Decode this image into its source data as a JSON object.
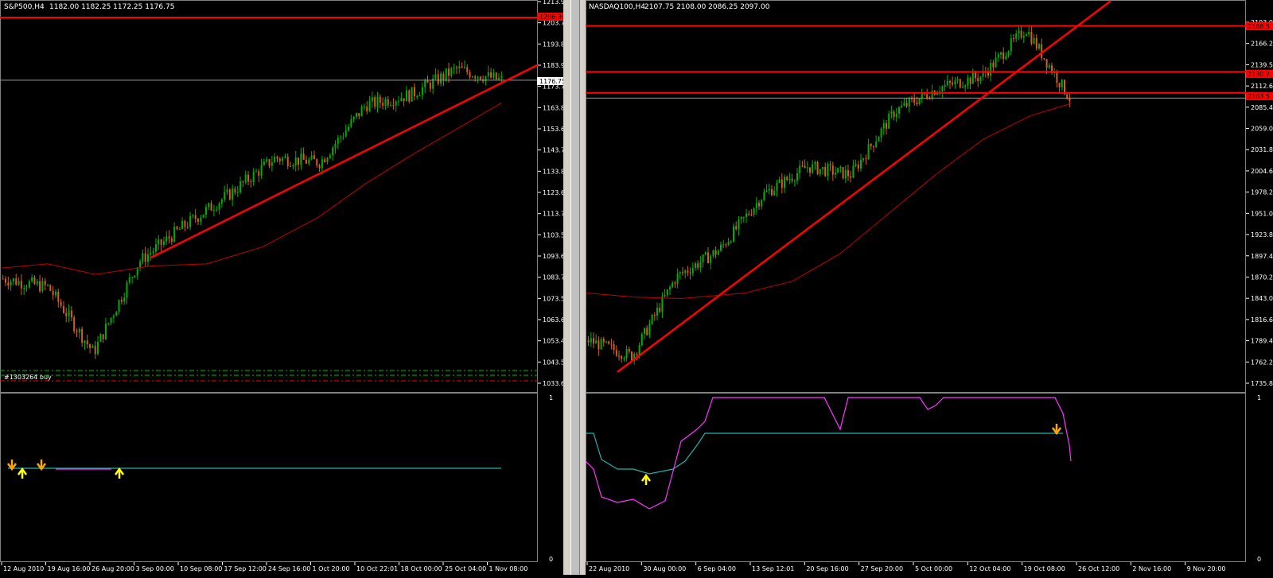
{
  "left_chart": {
    "title": "S&P500,H4",
    "ohlc": "1182.00 1182.25 1172.25 1176.75",
    "order_label": "#1303264 buy",
    "price_ticks": [
      "1213.90",
      "1203.70",
      "1193.80",
      "1183.90",
      "1173.70",
      "1163.80",
      "1153.60",
      "1143.70",
      "1133.80",
      "1123.60",
      "1113.70",
      "1103.50",
      "1093.60",
      "1083.70",
      "1073.50",
      "1063.60",
      "1053.40",
      "1043.50",
      "1033.60"
    ],
    "resistance_label": "1206.39",
    "current_label": "1176.75",
    "time_labels": [
      "12 Aug 2010",
      "19 Aug 16:00",
      "26 Aug 20:00",
      "3 Sep 00:00",
      "10 Sep 08:00",
      "17 Sep 12:00",
      "24 Sep 16:00",
      "1 Oct 20:00",
      "10 Oct 22:01",
      "18 Oct 00:00",
      "25 Oct 04:00",
      "1 Nov 08:00"
    ],
    "indicator_top": "1",
    "indicator_bottom": "0"
  },
  "right_chart": {
    "title": "NASDAQ100,H4",
    "ohlc": "2107.75 2108.00 2086.25 2097.00",
    "price_ticks": [
      "2193.0",
      "2166.2",
      "2139.5",
      "2112.6",
      "2085.4",
      "2059.0",
      "2031.8",
      "2004.6",
      "1978.2",
      "1951.0",
      "1923.8",
      "1897.4",
      "1870.2",
      "1843.0",
      "1816.6",
      "1789.4",
      "1762.2",
      "1735.8"
    ],
    "resistance_label_1": "2188.5",
    "resistance_label_2": "2130.2",
    "resistance_label_3": "2103.5",
    "current_label": "2097.0",
    "time_labels": [
      "22 Aug 2010",
      "30 Aug 00:00",
      "6 Sep 04:00",
      "13 Sep 12:01",
      "20 Sep 16:00",
      "27 Sep 20:00",
      "5 Oct 00:00",
      "12 Oct 04:00",
      "19 Oct 08:00",
      "26 Oct 12:00",
      "2 Nov 16:00",
      "9 Nov 20:00"
    ],
    "indicator_top": "1",
    "indicator_bottom": "0"
  },
  "colors": {
    "background": "#000000",
    "bull_candle": "#00b000",
    "bear_candle": "#d45f1a",
    "trendline": "#ff0000",
    "moving_average": "#c00000",
    "indicator_cyan": "#20b2aa",
    "indicator_magenta": "#ff33ff",
    "arrow_up": "#ffff00",
    "arrow_down": "#ffa500",
    "axis_text": "#ffffff",
    "grid": "#808080"
  },
  "chart_data": [
    {
      "type": "candlestick",
      "title": "S&P500,H4",
      "ylim": [
        1033.6,
        1213.9
      ],
      "x": [
        "12 Aug 2010",
        "19 Aug 16:00",
        "26 Aug 20:00",
        "3 Sep 00:00",
        "10 Sep 08:00",
        "17 Sep 12:00",
        "24 Sep 16:00",
        "1 Oct 20:00",
        "10 Oct 22:01",
        "18 Oct 00:00",
        "25 Oct 04:00",
        "1 Nov 08:00"
      ],
      "series": [
        {
          "name": "close",
          "values": [
            1083,
            1079,
            1048,
            1091,
            1108,
            1123,
            1140,
            1138,
            1165,
            1170,
            1182,
            1176.75
          ]
        }
      ],
      "trendline": [
        [
          1092.5
        ],
        [
          1183
        ]
      ],
      "horizontal_line": 1206.39,
      "current_price": 1176.75
    },
    {
      "type": "candlestick",
      "title": "NASDAQ100,H4",
      "ylim": [
        1735.8,
        2193.0
      ],
      "x": [
        "22 Aug 2010",
        "30 Aug 00:00",
        "6 Sep 04:00",
        "13 Sep 12:01",
        "20 Sep 16:00",
        "27 Sep 20:00",
        "5 Oct 00:00",
        "12 Oct 04:00",
        "19 Oct 08:00",
        "26 Oct 12:00",
        "2 Nov 16:00",
        "9 Nov 20:00"
      ],
      "series": [
        {
          "name": "close",
          "values": [
            1790,
            1770,
            1870,
            1905,
            1975,
            2010,
            2000,
            2080,
            2110,
            2125,
            2185,
            2097
          ]
        }
      ],
      "horizontal_lines": [
        2188.5,
        2130.2,
        2103.5
      ],
      "current_price": 2097.0
    }
  ]
}
